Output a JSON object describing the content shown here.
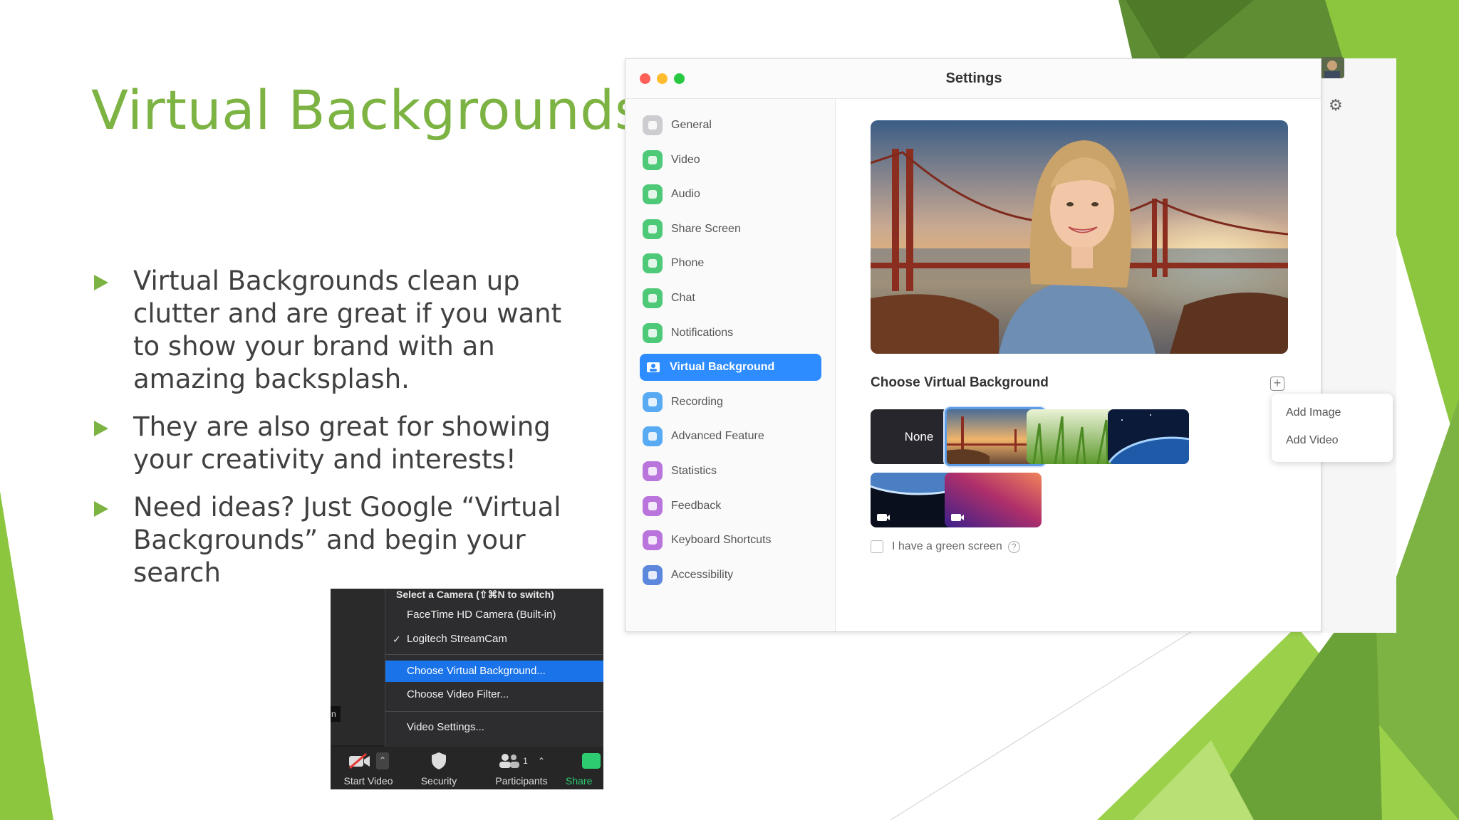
{
  "slide": {
    "title": "Virtual Backgrounds",
    "bullets": [
      "Virtual Backgrounds clean up clutter and are great if you want to show your brand with an amazing backsplash.",
      "They are also great for showing your creativity and interests!",
      "Need ideas? Just Google “Virtual Backgrounds” and begin your search"
    ]
  },
  "camera_menu": {
    "header": "Select a Camera (⇧⌘N to switch)",
    "items": [
      {
        "label": "FaceTime HD Camera (Built-in)",
        "checked": false
      },
      {
        "label": "Logitech StreamCam",
        "checked": true
      },
      {
        "label": "Choose Virtual Background...",
        "selected": true
      },
      {
        "label": "Choose Video Filter..."
      },
      {
        "label": "Video Settings..."
      }
    ],
    "check_glyph": "✓",
    "side_letter": "n",
    "toolbar": [
      {
        "label": "Start Video",
        "icon": "video-off-icon"
      },
      {
        "label": "Security",
        "icon": "shield-icon"
      },
      {
        "label": "Participants",
        "icon": "participants-icon",
        "count": "1"
      },
      {
        "label": "Share",
        "icon": "share-icon"
      }
    ]
  },
  "settings": {
    "window_title": "Settings",
    "nav": [
      {
        "label": "General",
        "icon": "general-icon",
        "color": "#c9c9cd"
      },
      {
        "label": "Video",
        "icon": "video-icon",
        "color": "#3cc46b"
      },
      {
        "label": "Audio",
        "icon": "headphones-icon",
        "color": "#3cc46b"
      },
      {
        "label": "Share Screen",
        "icon": "share-screen-icon",
        "color": "#3cc46b"
      },
      {
        "label": "Phone",
        "icon": "phone-icon",
        "color": "#3cc46b"
      },
      {
        "label": "Chat",
        "icon": "chat-icon",
        "color": "#3cc46b"
      },
      {
        "label": "Notifications",
        "icon": "bell-icon",
        "color": "#3cc46b"
      },
      {
        "label": "Virtual Background",
        "icon": "virtual-background-icon",
        "color": "#ffffff",
        "active": true
      },
      {
        "label": "Recording",
        "icon": "record-icon",
        "color": "#47a3f3"
      },
      {
        "label": "Advanced Feature",
        "icon": "sparkle-icon",
        "color": "#47a3f3"
      },
      {
        "label": "Statistics",
        "icon": "bar-chart-icon",
        "color": "#b467d9"
      },
      {
        "label": "Feedback",
        "icon": "feedback-icon",
        "color": "#b467d9"
      },
      {
        "label": "Keyboard Shortcuts",
        "icon": "keyboard-icon",
        "color": "#b467d9"
      },
      {
        "label": "Accessibility",
        "icon": "accessibility-icon",
        "color": "#4b7bd9"
      }
    ],
    "choose_label": "Choose Virtual Background",
    "none_label": "None",
    "popup": {
      "add_image": "Add Image",
      "add_video": "Add Video"
    },
    "green_screen_label": "I have a green screen",
    "question_glyph": "?",
    "plus_glyph": "+",
    "gear_glyph": "⚙"
  },
  "colors": {
    "accent_green": "#7cb342",
    "zoom_blue": "#2d8cff",
    "menu_selected": "#1a73e8"
  }
}
